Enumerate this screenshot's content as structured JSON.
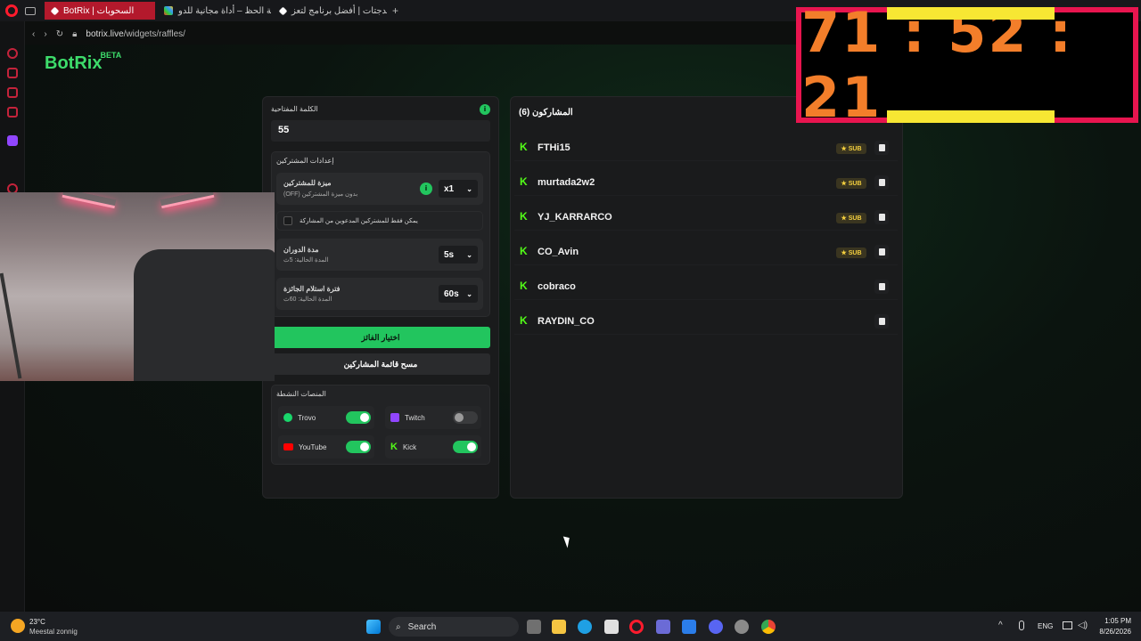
{
  "browser": {
    "tabs": [
      {
        "label": "BotRix | السحوبات",
        "active": true
      },
      {
        "label": "عجلة الحظ – أداة مجانية للدو",
        "active": false
      },
      {
        "label": "الويدجتات | أفضل برنامج لتعز",
        "active": false
      }
    ],
    "url_host": "botrix.live",
    "url_path": "/widgets/raffles/"
  },
  "app": {
    "logo": "BotRix",
    "logo_badge": "BETA"
  },
  "settings": {
    "keyword_label": "الكلمة المفتاحية",
    "keyword_value": "55",
    "subscribers_section": "إعدادات المشتركين",
    "sub_advantage_title": "ميزة للمشتركين",
    "sub_advantage_desc": "بدون ميزة المشتركين (OFF)",
    "sub_advantage_value": "x1",
    "only_subs_label": "يمكن فقط للمشتركين المدعوين من المشاركة",
    "spin_title": "مدة الدوران",
    "spin_desc": "المدة الحالية: 5ث",
    "spin_value": "5s",
    "claim_title": "فترة استلام الجائزة",
    "claim_desc": "المدة الحالية: 60ث",
    "claim_value": "60s",
    "pick_winner": "اختيار الفائز",
    "clear_list": "مسح قائمة المشاركين",
    "platforms_label": "المنصات النشطة",
    "platforms": [
      {
        "name": "Trovo",
        "on": true,
        "color": "#19d66b"
      },
      {
        "name": "Twitch",
        "on": false,
        "color": "#9146ff"
      },
      {
        "name": "YouTube",
        "on": true,
        "color": "#ff0000"
      },
      {
        "name": "Kick",
        "on": true,
        "color": "#53fc18"
      }
    ]
  },
  "participants": {
    "header": "المشاركون (6)",
    "sub_badge": "SUB",
    "list": [
      {
        "name": "FTHi15",
        "sub": true
      },
      {
        "name": "murtada2w2",
        "sub": true
      },
      {
        "name": "YJ_KARRARCO",
        "sub": true
      },
      {
        "name": "CO_Avin",
        "sub": true
      },
      {
        "name": "cobraco",
        "sub": false
      },
      {
        "name": "RAYDIN_CO",
        "sub": false
      }
    ]
  },
  "overlay": {
    "timer": "71 : 52 : 21"
  },
  "taskbar": {
    "weather_temp": "23°C",
    "weather_desc": "Meestal zonnig",
    "search": "Search",
    "lang": "ENG",
    "time": "1:05 PM",
    "date": "8/26/2026"
  },
  "colors": {
    "accent": "#22c55e",
    "timer_border": "#e8154f",
    "timer_digits": "#f37e2a",
    "tab_active": "#b3192c"
  }
}
